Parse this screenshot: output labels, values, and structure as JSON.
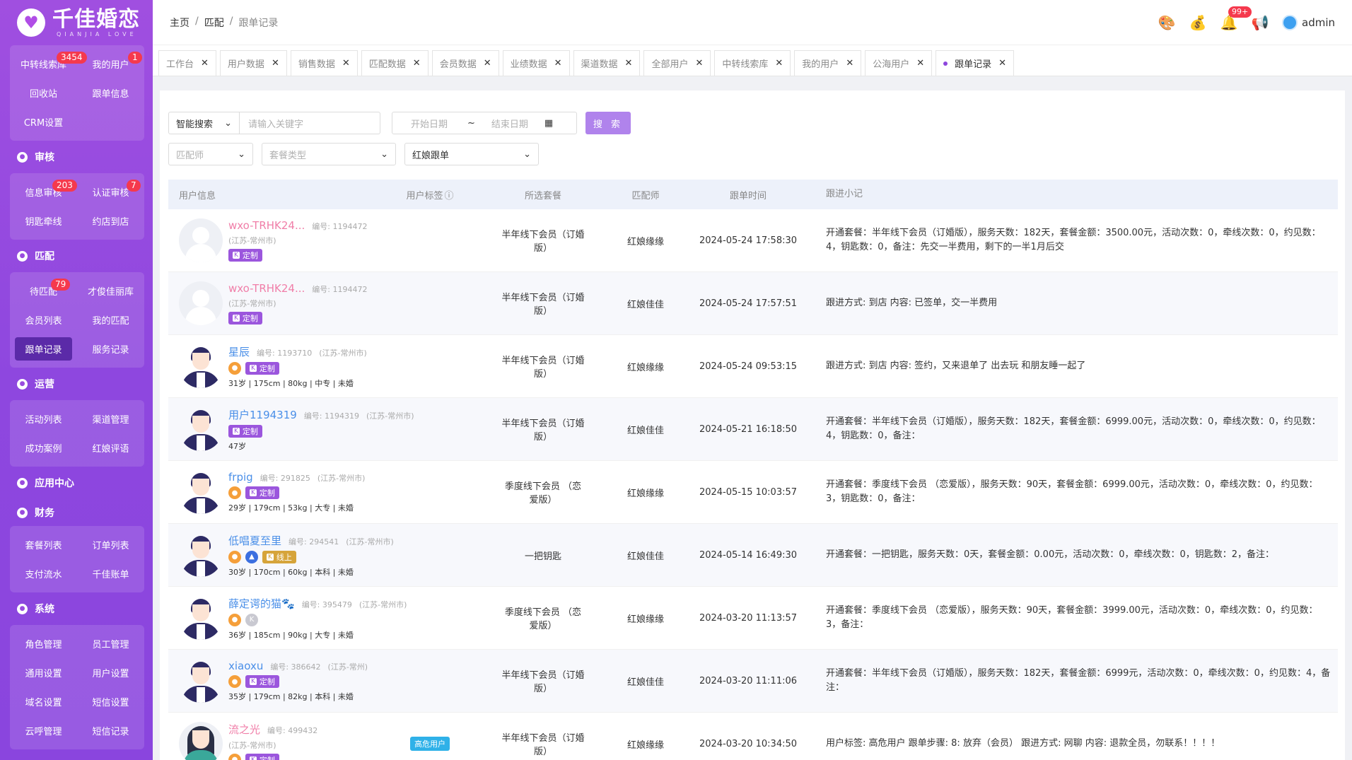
{
  "logo": {
    "cn": "千佳婚恋",
    "en": "QIANJIA LOVE"
  },
  "sidebar": {
    "group1": [
      {
        "label": "中转线索库",
        "badge": "3454"
      },
      {
        "label": "我的用户",
        "badge": "1"
      },
      {
        "label": "回收站"
      },
      {
        "label": "跟单信息"
      },
      {
        "label": "CRM设置"
      }
    ],
    "sec_audit": "审核",
    "group2": [
      {
        "label": "信息审核",
        "badge": "203"
      },
      {
        "label": "认证审核",
        "badge": "7"
      },
      {
        "label": "钥匙牵线"
      },
      {
        "label": "约店到店"
      }
    ],
    "sec_match": "匹配",
    "group3": [
      {
        "label": "待匹配",
        "badge": "79"
      },
      {
        "label": "才俊佳丽库"
      },
      {
        "label": "会员列表"
      },
      {
        "label": "我的匹配"
      },
      {
        "label": "跟单记录"
      },
      {
        "label": "服务记录"
      }
    ],
    "sec_ops": "运营",
    "group4": [
      {
        "label": "活动列表"
      },
      {
        "label": "渠道管理"
      },
      {
        "label": "成功案例"
      },
      {
        "label": "红娘评语"
      }
    ],
    "sec_app": "应用中心",
    "sec_fin": "财务",
    "group5": [
      {
        "label": "套餐列表"
      },
      {
        "label": "订单列表"
      },
      {
        "label": "支付流水"
      },
      {
        "label": "千佳账单"
      }
    ],
    "sec_sys": "系统",
    "group6": [
      {
        "label": "角色管理"
      },
      {
        "label": "员工管理"
      },
      {
        "label": "通用设置"
      },
      {
        "label": "用户设置"
      },
      {
        "label": "域名设置"
      },
      {
        "label": "短信设置"
      },
      {
        "label": "云呼管理"
      },
      {
        "label": "短信记录"
      }
    ]
  },
  "breadcrumb": {
    "home": "主页",
    "sep": "/",
    "mid": "匹配",
    "cur": "跟单记录"
  },
  "header": {
    "notice_badge": "99+",
    "user": "admin"
  },
  "tabs": [
    "工作台",
    "用户数据",
    "销售数据",
    "匹配数据",
    "会员数据",
    "业绩数据",
    "渠道数据",
    "全部用户",
    "中转线索库",
    "我的用户",
    "公海用户",
    "跟单记录"
  ],
  "filters": {
    "search_type": "智能搜索",
    "keyword_placeholder": "请输入关键字",
    "start_date": "开始日期",
    "date_sep": "~",
    "end_date": "结束日期",
    "search_btn": "搜 索",
    "matchmaker_ph": "匹配师",
    "package_ph": "套餐类型",
    "follow_type": "红娘跟单"
  },
  "table": {
    "headers": [
      "用户信息",
      "用户标签",
      "所选套餐",
      "匹配师",
      "跟单时间",
      "跟进小记"
    ],
    "rows": [
      {
        "name": "wxo-TRHK24...",
        "id": "编号: 1194472",
        "loc": "(江苏-常州市)",
        "stats": "",
        "tag": "",
        "package": "半年线下会员（订婚版）",
        "mm": "红娘缘缘",
        "time": "2024-05-24 17:58:30",
        "note": "开通套餐：半年线下会员（订婚版），服务天数：182天，套餐金额：3500.00元，活动次数：0，牵线次数：0，约见数：4，钥匙数：0，备注：先交一半费用，剩下的一半1月后交"
      },
      {
        "name": "wxo-TRHK24...",
        "id": "编号: 1194472",
        "loc": "(江苏-常州市)",
        "stats": "",
        "tag": "",
        "package": "半年线下会员（订婚版）",
        "mm": "红娘佳佳",
        "time": "2024-05-24 17:57:51",
        "note": "跟进方式: 到店 内容: 已签单，交一半费用"
      },
      {
        "name": "星辰",
        "id": "编号: 1193710",
        "loc": "(江苏-常州市)",
        "stats": "31岁 | 175cm | 80kg | 中专 | 未婚",
        "tag": "",
        "package": "半年线下会员（订婚版）",
        "mm": "红娘缘缘",
        "time": "2024-05-24 09:53:15",
        "note": "跟进方式: 到店 内容: 签约，又来退单了 出去玩 和朋友睡一起了"
      },
      {
        "name": "用户1194319",
        "id": "编号: 1194319",
        "loc": "(江苏-常州市)",
        "stats": "47岁",
        "tag": "",
        "package": "半年线下会员（订婚版）",
        "mm": "红娘佳佳",
        "time": "2024-05-21 16:18:50",
        "note": "开通套餐：半年线下会员（订婚版），服务天数：182天，套餐金额：6999.00元，活动次数：0，牵线次数：0，约见数：4，钥匙数：0，备注："
      },
      {
        "name": "frpig",
        "id": "编号: 291825",
        "loc": "(江苏-常州市)",
        "stats": "29岁 | 179cm | 53kg | 大专 | 未婚",
        "tag": "",
        "package": "季度线下会员 （恋爱版）",
        "mm": "红娘缘缘",
        "time": "2024-05-15 10:03:57",
        "note": "开通套餐：季度线下会员 （恋爱版），服务天数：90天，套餐金额：6999.00元，活动次数：0，牵线次数：0，约见数：3，钥匙数：0，备注："
      },
      {
        "name": "低唱夏至里",
        "id": "编号: 294541",
        "loc": "(江苏-常州市)",
        "stats": "30岁 | 170cm | 60kg | 本科 | 未婚",
        "tag": "",
        "package": "一把钥匙",
        "mm": "红娘佳佳",
        "time": "2024-05-14 16:49:30",
        "note": "开通套餐：一把钥匙，服务天数：0天，套餐金额：0.00元，活动次数：0，牵线次数：0，钥匙数：2，备注："
      },
      {
        "name": "薛定谔的猫🐾",
        "id": "编号: 395479",
        "loc": "(江苏-常州市)",
        "stats": "36岁 | 185cm | 90kg | 大专 | 未婚",
        "tag": "",
        "package": "季度线下会员 （恋爱版）",
        "mm": "红娘缘缘",
        "time": "2024-03-20 11:13:57",
        "note": "开通套餐：季度线下会员 （恋爱版），服务天数：90天，套餐金额：3999.00元，活动次数：0，牵线次数：0，约见数：3，备注："
      },
      {
        "name": "xiaoxu",
        "id": "编号: 386642",
        "loc": "(江苏-常州)",
        "stats": "35岁 | 179cm | 82kg | 本科 | 未婚",
        "tag": "",
        "package": "半年线下会员（订婚版）",
        "mm": "红娘佳佳",
        "time": "2024-03-20 11:11:06",
        "note": "开通套餐：半年线下会员（订婚版），服务天数：182天，套餐金额：6999元，活动次数：0，牵线次数：0，约见数：4，备注："
      },
      {
        "name": "流之光",
        "id": "编号: 499432",
        "loc": "(江苏-常州市)",
        "stats": "",
        "tag": "高危用户",
        "package": "半年线下会员（订婚版）",
        "mm": "红娘缘缘",
        "time": "2024-03-20 10:34:50",
        "note": "用户标签: 高危用户 跟单步骤: 8: 放弃（会员） 跟进方式: 网聊 内容: 退款全员，勿联系！！！！"
      }
    ],
    "tag_custom": "定制",
    "tag_online": "线上",
    "k": "K"
  },
  "colors": {
    "accent": "#8d46dd",
    "badge": "#f5394d",
    "pink_name": "#f07ea8",
    "blue_name": "#4a8fe8"
  }
}
